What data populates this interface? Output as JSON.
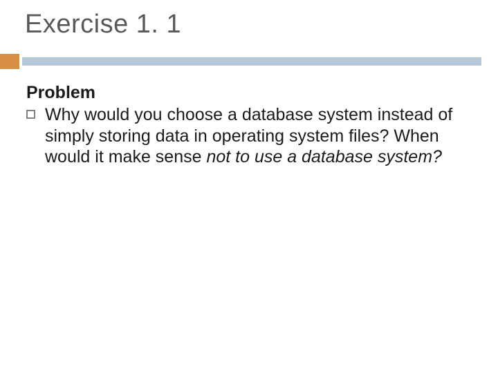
{
  "title": "Exercise 1. 1",
  "problem_label": "Problem",
  "question_part1": "Why would you choose a database system instead of simply storing data in operating system files? When would it make sense ",
  "question_italic": "not to use a database system?"
}
